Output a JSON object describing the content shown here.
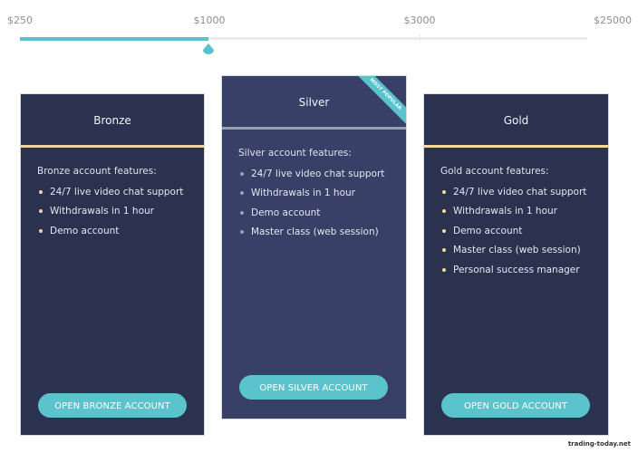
{
  "slider": {
    "ticks": [
      "$250",
      "$1000",
      "$3000",
      "$25000"
    ],
    "selected_value": "$1000",
    "progress_fraction": 0.333,
    "colors": {
      "fill": "#57c3cc",
      "track": "#e8ebf0"
    }
  },
  "plans": [
    {
      "name": "Bronze",
      "features_heading": "Bronze account features:",
      "features": [
        "24/7 live video chat support",
        "Withdrawals in 1 hour",
        "Demo account"
      ],
      "cta": "OPEN BRONZE ACCOUNT",
      "accent": "#f5cfa8"
    },
    {
      "name": "Silver",
      "badge": "MOST POPULAR",
      "features_heading": "Silver account features:",
      "features": [
        "24/7 live video chat support",
        "Withdrawals in 1 hour",
        "Demo account",
        "Master class (web session)"
      ],
      "cta": "OPEN SILVER ACCOUNT",
      "accent": "#9aa0b4"
    },
    {
      "name": "Gold",
      "features_heading": "Gold account features:",
      "features": [
        "24/7 live video chat support",
        "Withdrawals in 1 hour",
        "Demo account",
        "Master class (web session)",
        "Personal success manager"
      ],
      "cta": "OPEN GOLD ACCOUNT",
      "accent": "#f6d99a"
    }
  ],
  "colors": {
    "card_bg": "#2b3250",
    "featured_bg": "#384068",
    "button": "#5ac3cb"
  },
  "watermark": "trading-today.net"
}
